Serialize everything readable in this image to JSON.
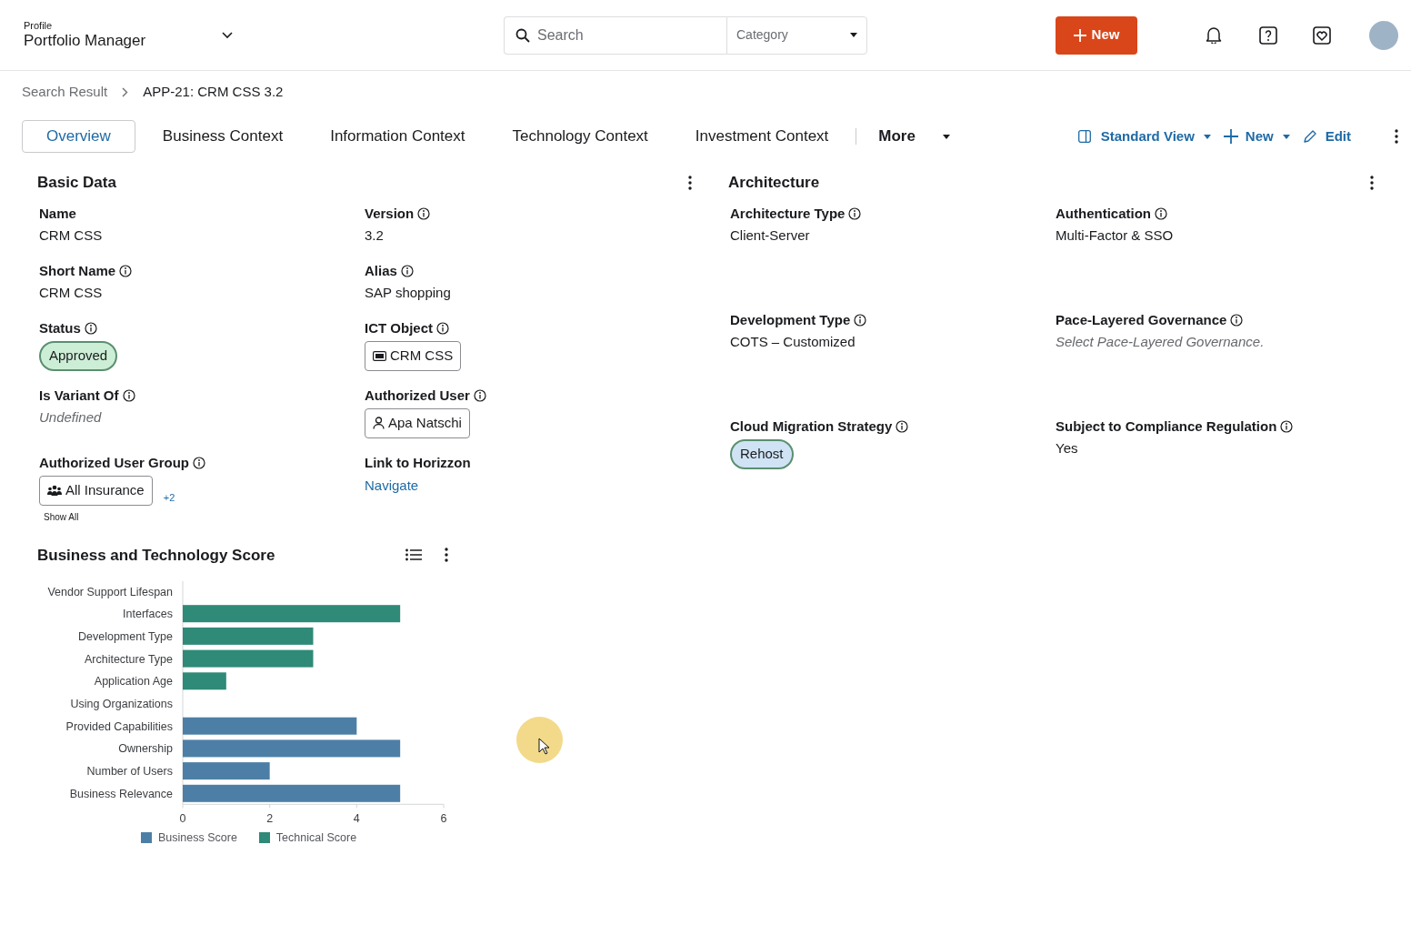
{
  "header": {
    "profile_label": "Profile",
    "profile_name": "Portfolio Manager",
    "search": {
      "placeholder": "Search"
    },
    "category": {
      "placeholder": "Category"
    },
    "new_button": "New"
  },
  "breadcrumb": [
    {
      "label": "Search Result",
      "current": false
    },
    {
      "label": "APP-21: CRM CSS 3.2",
      "current": true
    }
  ],
  "tabs": [
    {
      "label": "Overview",
      "selected": true
    },
    {
      "label": "Business Context",
      "selected": false
    },
    {
      "label": "Information Context",
      "selected": false
    },
    {
      "label": "Technology Context",
      "selected": false
    },
    {
      "label": "Investment Context",
      "selected": false
    }
  ],
  "more_tab": "More",
  "actions": [
    {
      "kind": "view",
      "label": "Standard View"
    },
    {
      "kind": "new",
      "label": "New"
    },
    {
      "kind": "edit",
      "label": "Edit"
    }
  ],
  "basic_data": {
    "title": "Basic Data",
    "fields": [
      {
        "label": "Name",
        "info": false,
        "kind": "text",
        "value": "CRM CSS"
      },
      {
        "label": "Version",
        "info": true,
        "kind": "text",
        "value": "3.2"
      },
      {
        "label": "Short Name",
        "info": true,
        "kind": "text",
        "value": "CRM CSS"
      },
      {
        "label": "Alias",
        "info": true,
        "kind": "text",
        "value": "SAP shopping"
      },
      {
        "label": "Status",
        "info": true,
        "kind": "pill",
        "value": "Approved",
        "color": "#cdeed6"
      },
      {
        "label": "ICT Object",
        "info": true,
        "kind": "ict_chip",
        "value": "CRM CSS"
      },
      {
        "label": "Is Variant Of",
        "info": true,
        "kind": "empty",
        "value": "Undefined"
      },
      {
        "label": "Authorized User",
        "info": true,
        "kind": "user_chip",
        "value": "Apa Natschi"
      },
      {
        "label": "Authorized User Group",
        "info": true,
        "kind": "group_chip",
        "value": "All Insurance",
        "extra": "+2",
        "show_all": "Show All"
      },
      {
        "label": "Link to Horizzon",
        "info": false,
        "kind": "link",
        "value": "Navigate"
      }
    ]
  },
  "architecture": {
    "title": "Architecture",
    "fields": [
      {
        "label": "Architecture Type",
        "info": true,
        "kind": "text",
        "value": "Client-Server"
      },
      {
        "label": "Authentication",
        "info": true,
        "kind": "text",
        "value": "Multi-Factor & SSO"
      },
      {
        "label": "Development Type",
        "info": true,
        "kind": "text",
        "value": "COTS – Customized"
      },
      {
        "label": "Pace-Layered Governance",
        "info": true,
        "kind": "empty",
        "value": "Select Pace-Layered Governance."
      },
      {
        "label": "Cloud Migration Strategy",
        "info": true,
        "kind": "pill",
        "value": "Rehost",
        "color": "#cfe3f4"
      },
      {
        "label": "Subject to Compliance Regulation",
        "info": true,
        "kind": "text",
        "value": "Yes"
      }
    ]
  },
  "score": {
    "title": "Business and Technology Score",
    "chart_data": {
      "type": "bar",
      "orientation": "horizontal",
      "stacked": true,
      "categories": [
        "Vendor Support Lifespan",
        "Interfaces",
        "Development Type",
        "Architecture Type",
        "Application Age",
        "Using Organizations",
        "Provided Capabilities",
        "Ownership",
        "Number of Users",
        "Business Relevance"
      ],
      "series": [
        {
          "name": "Business Score",
          "color": "#4d7fa6",
          "values": [
            null,
            null,
            null,
            null,
            null,
            0,
            4,
            5,
            2,
            5
          ]
        },
        {
          "name": "Technical Score",
          "color": "#2f8a78",
          "values": [
            0,
            5,
            3,
            3,
            1,
            null,
            null,
            null,
            null,
            null
          ]
        }
      ],
      "xlim": [
        0,
        6
      ],
      "xticks": [
        0,
        2,
        4,
        6
      ],
      "legend": "bottom"
    }
  }
}
